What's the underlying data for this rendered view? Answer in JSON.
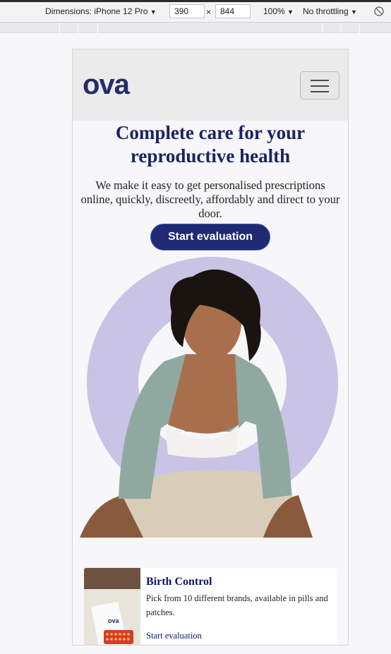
{
  "devtools": {
    "dimensions_label": "Dimensions: iPhone 12 Pro",
    "width_value": "390",
    "height_value": "844",
    "times_symbol": "×",
    "zoom_label": "100%",
    "throttling_label": "No throttling",
    "dropdown_caret": "▼"
  },
  "nav": {
    "logo_text": "ova"
  },
  "hero": {
    "title": "Complete care for your reproductive health",
    "subtitle": "We make it easy to get personalised prescriptions online, quickly, discreetly, affordably and direct to your door.",
    "cta_label": "Start evaluation"
  },
  "cards": [
    {
      "title": "Birth Control",
      "description": "Pick from 10 different brands, available in pills and patches.",
      "link_label": "Start evaluation",
      "badge_text": "ova"
    }
  ],
  "colors": {
    "brand_navy": "#1a2363",
    "cta_background": "#1f2a72",
    "circle_lavender": "#c9c3e6"
  }
}
